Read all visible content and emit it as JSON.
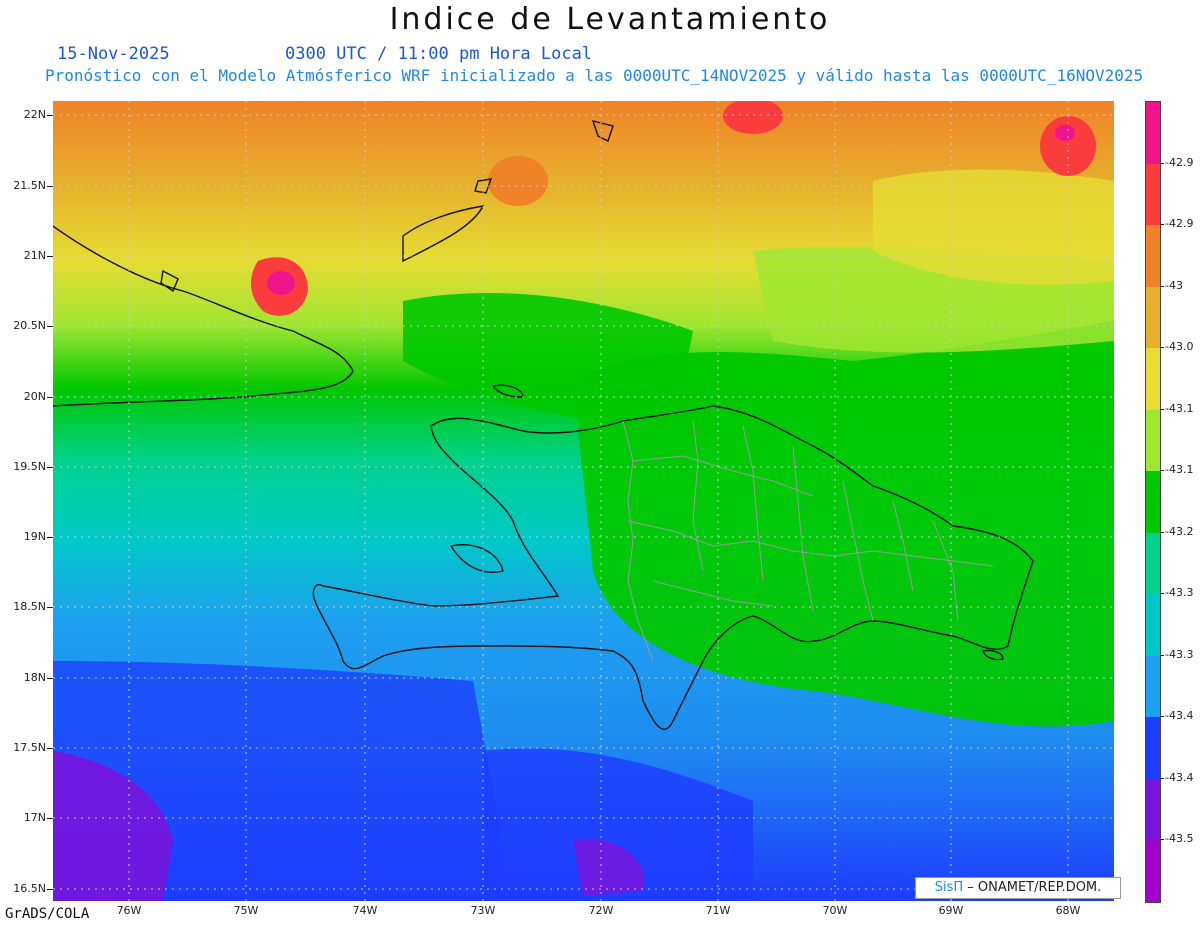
{
  "header": {
    "title": "Indice de Levantamiento",
    "date": "15-Nov-2025",
    "time": "0300 UTC / 11:00 pm Hora Local",
    "subtitle": "Pronóstico con el Modelo Atmósferico WRF inicializado a las 0000UTC_14NOV2025 y válido hasta las  0000UTC_16NOV2025"
  },
  "map": {
    "lat_labels": [
      "22N",
      "21.5N",
      "21N",
      "20.5N",
      "20N",
      "19.5N",
      "19N",
      "18.5N",
      "18N",
      "17.5N",
      "17N",
      "16.5N"
    ],
    "lon_labels": [
      "76W",
      "75W",
      "74W",
      "73W",
      "72W",
      "71W",
      "70W",
      "69W",
      "68W"
    ],
    "background_color": "#1ec41e"
  },
  "colorbar": {
    "labels": [
      "-42.9",
      "-42.9",
      "-43",
      "-43.0",
      "-43.1",
      "-43.1",
      "-43.2",
      "-43.3",
      "-43.3",
      "-43.4",
      "-43.4",
      "-43.5"
    ],
    "colors": [
      "#f0148c",
      "#fa3c3c",
      "#f08228",
      "#e6af2d",
      "#e6dc32",
      "#a0e632",
      "#00c800",
      "#00d28c",
      "#00c8c8",
      "#1ea0f0",
      "#1e3cff",
      "#7814dc",
      "#a000c8"
    ]
  },
  "credit": {
    "brand": "SisΠ",
    "text": "– ONAMET/REP.DOM."
  },
  "footer": {
    "software": "GrADS/COLA"
  }
}
